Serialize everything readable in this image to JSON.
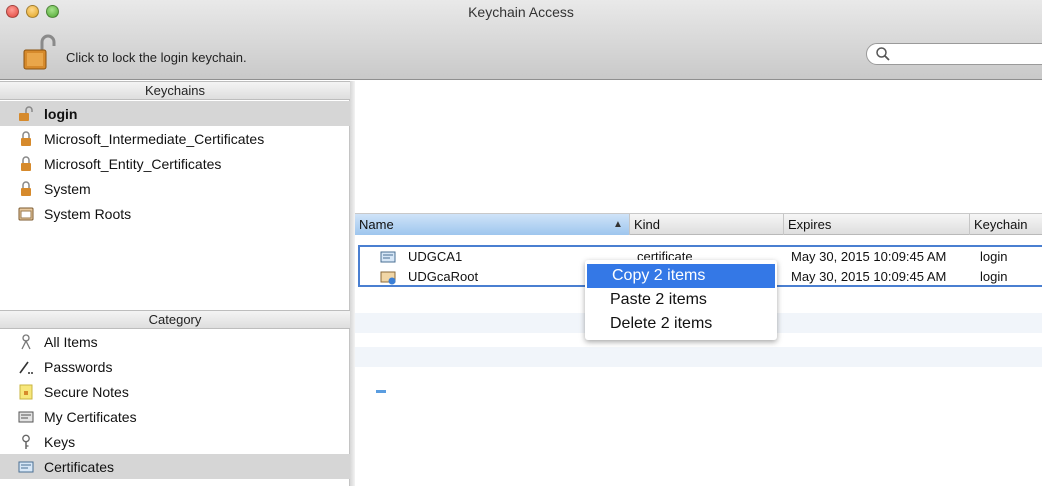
{
  "window": {
    "title": "Keychain Access"
  },
  "toolbar": {
    "lock_label": "Click to lock the login keychain.",
    "search_placeholder": ""
  },
  "sidebar": {
    "keychains_header": "Keychains",
    "keychains": [
      {
        "label": "login",
        "icon": "unlocked-padlock-icon",
        "selected": true
      },
      {
        "label": "Microsoft_Intermediate_Certificates",
        "icon": "padlock-icon"
      },
      {
        "label": "Microsoft_Entity_Certificates",
        "icon": "padlock-icon"
      },
      {
        "label": "System",
        "icon": "padlock-icon"
      },
      {
        "label": "System Roots",
        "icon": "cabinet-icon"
      }
    ],
    "category_header": "Category",
    "categories": [
      {
        "label": "All Items",
        "icon": "all-items-icon"
      },
      {
        "label": "Passwords",
        "icon": "password-icon"
      },
      {
        "label": "Secure Notes",
        "icon": "secure-note-icon"
      },
      {
        "label": "My Certificates",
        "icon": "my-certificate-icon"
      },
      {
        "label": "Keys",
        "icon": "key-icon"
      },
      {
        "label": "Certificates",
        "icon": "certificate-icon",
        "selected": true
      }
    ]
  },
  "table": {
    "columns": {
      "name": "Name",
      "kind": "Kind",
      "expires": "Expires",
      "keychain": "Keychain"
    },
    "rows": [
      {
        "name": "UDGCA1",
        "kind": "certificate",
        "expires": "May 30, 2015 10:09:45 AM",
        "keychain": "login"
      },
      {
        "name": "UDGcaRoot",
        "kind": "",
        "expires": "May 30, 2015 10:09:45 AM",
        "keychain": "login"
      }
    ]
  },
  "context_menu": {
    "items": [
      "Copy 2 items",
      "Paste 2 items",
      "Delete 2 items"
    ],
    "highlighted_index": 0
  },
  "colors": {
    "selection_blue": "#3478e6",
    "selection_border": "#4a7fd1",
    "sidebar_selected": "#d6d6d6"
  }
}
